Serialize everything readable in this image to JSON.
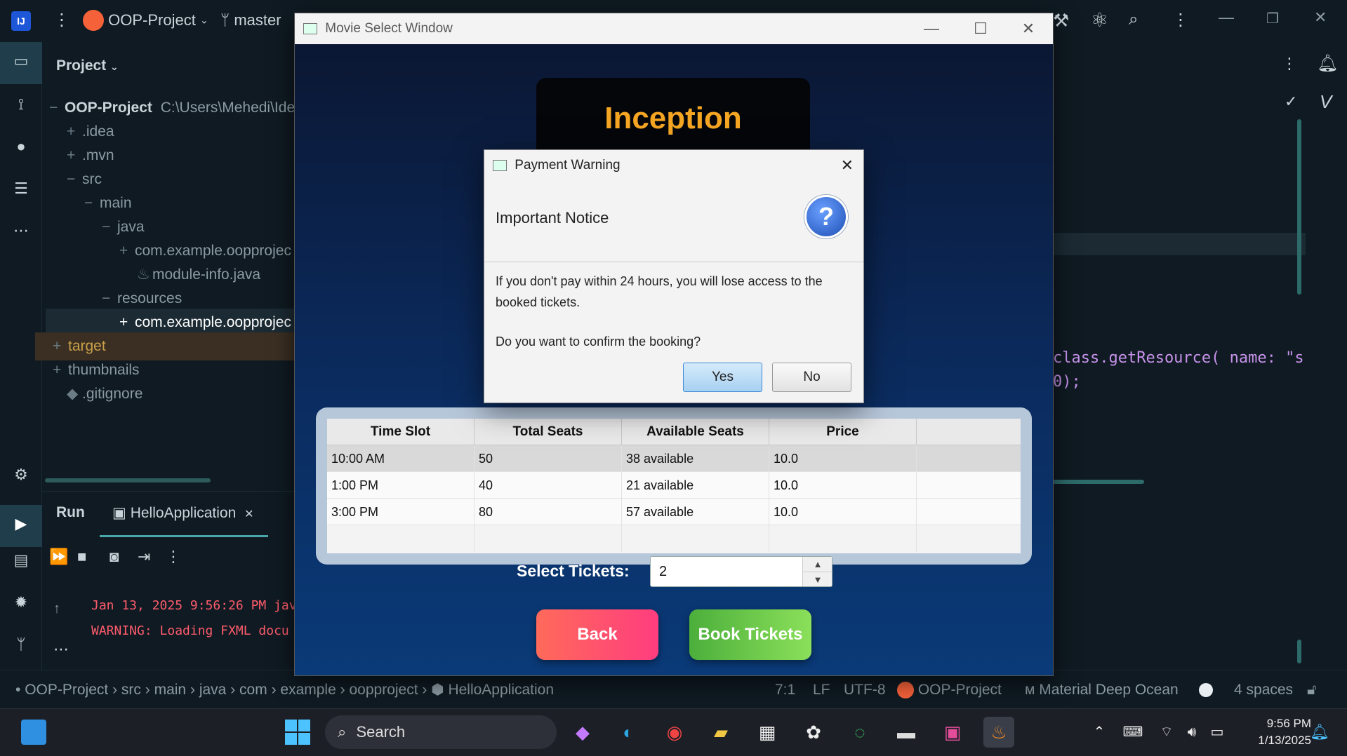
{
  "ide": {
    "project_name": "OOP-Project",
    "branch": "master",
    "project_panel_title": "Project",
    "root_label": "OOP-Project",
    "root_path": "C:\\Users\\Mehedi\\Ide",
    "tree": [
      {
        "label": ".idea",
        "pm": "+"
      },
      {
        "label": ".mvn",
        "pm": "+"
      },
      {
        "label": "src",
        "pm": "−"
      },
      {
        "label": "main",
        "pm": "−"
      },
      {
        "label": "java",
        "pm": "−"
      },
      {
        "label": "com.example.oopprojec",
        "pm": "+"
      },
      {
        "label": "module-info.java",
        "pm": ""
      },
      {
        "label": "resources",
        "pm": "−"
      },
      {
        "label": "com.example.oopprojec",
        "pm": "+"
      },
      {
        "label": "target",
        "pm": "+"
      },
      {
        "label": "thumbnails",
        "pm": "+"
      },
      {
        "label": ".gitignore",
        "pm": ""
      }
    ],
    "run_label": "Run",
    "run_tab": "HelloApplication",
    "console_lines": [
      "Jan 13, 2025 9:56:26 PM jav",
      "WARNING: Loading FXML docu"
    ],
    "code_lines": [
      "class.getResource( name: \"s",
      "0);"
    ],
    "status": {
      "breadcrumb": [
        "OOP-Project",
        "src",
        "main",
        "java",
        "com",
        "example",
        "oopproject",
        "HelloApplication"
      ],
      "position": "7:1",
      "line_sep": "LF",
      "encoding": "UTF-8",
      "project": "OOP-Project",
      "theme": "Material Deep Ocean",
      "indent": "4 spaces"
    }
  },
  "movie_window": {
    "title": "Movie Select Window",
    "movie_title": "Inception",
    "table": {
      "headers": [
        "Time Slot",
        "Total Seats",
        "Available Seats",
        "Price"
      ],
      "rows": [
        [
          "10:00 AM",
          "50",
          "38 available",
          "10.0"
        ],
        [
          "1:00 PM",
          "40",
          "21 available",
          "10.0"
        ],
        [
          "3:00 PM",
          "80",
          "57 available",
          "10.0"
        ]
      ]
    },
    "select_tickets_label": "Select Tickets:",
    "tickets_value": "2",
    "back_label": "Back",
    "book_label": "Book Tickets"
  },
  "dialog": {
    "title": "Payment Warning",
    "header": "Important Notice",
    "message_1": "If you don't pay within 24 hours, you will lose access to the booked tickets.",
    "message_2": "Do you want to confirm the booking?",
    "yes_label": "Yes",
    "no_label": "No"
  },
  "taskbar": {
    "search_label": "Search",
    "time": "9:56 PM",
    "date": "1/13/2025"
  }
}
